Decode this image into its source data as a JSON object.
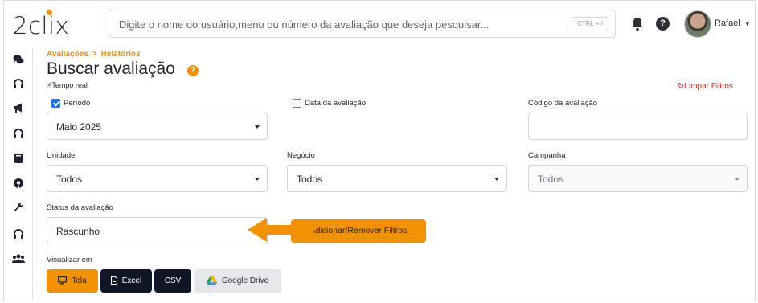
{
  "app": {
    "logo": "2clix",
    "user_name": "Rafael"
  },
  "search": {
    "placeholder": "Digite o nome do usuário,menu ou número da avaliação que deseja pesquisar...",
    "shortcut": "CTRL + /"
  },
  "breadcrumb": {
    "items": [
      "Avaliações",
      "Relatórios"
    ],
    "separator": ">"
  },
  "page": {
    "title": "Buscar avaliação",
    "help_badge": "?",
    "realtime_label": "Tempo real",
    "clear_filters": "Limpar Filtros"
  },
  "filters": {
    "periodo": {
      "label": "Período",
      "checked": true,
      "value": "Maio 2025"
    },
    "data_avaliacao": {
      "label": "Data da avaliação",
      "checked": false
    },
    "codigo": {
      "label": "Código da avaliação",
      "value": ""
    },
    "unidade": {
      "label": "Unidade",
      "value": "Todos"
    },
    "negocio": {
      "label": "Negócio",
      "value": "Todos"
    },
    "campanha": {
      "label": "Campanha",
      "value": "Todos"
    },
    "status": {
      "label": "Status da avaliação",
      "value": "Rascunho"
    }
  },
  "actions": {
    "add_remove_filters": "Adicionar/Remover Filtros"
  },
  "view": {
    "label": "Visualizar em",
    "buttons": [
      {
        "label": "Tela",
        "icon": "monitor-icon"
      },
      {
        "label": "Excel",
        "icon": "file-icon"
      },
      {
        "label": "CSV",
        "icon": ""
      },
      {
        "label": "Google Drive",
        "icon": "google-drive-icon"
      }
    ]
  },
  "colors": {
    "accent": "#f39200",
    "dark_button": "#0f1626",
    "danger": "#d22b2b",
    "checkbox": "#1a73e8"
  }
}
